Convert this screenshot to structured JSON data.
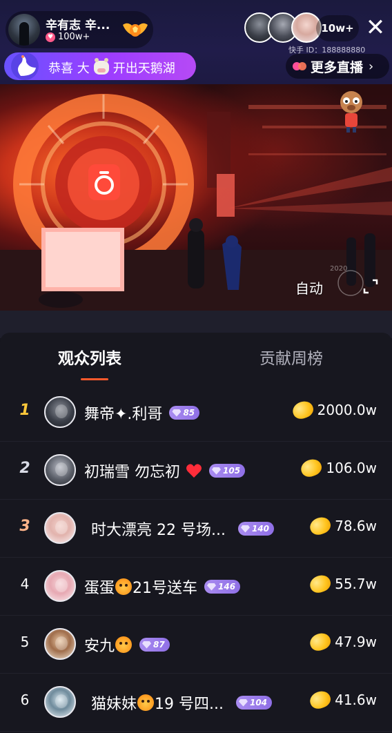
{
  "header": {
    "host_name": "辛有志 辛...",
    "host_likes": "100w+",
    "viewer_count": "10w+",
    "kuaishou_id": "快手 ID：188888880",
    "notification_prefix": "恭喜 大",
    "notification_suffix": "开出天鹅湖",
    "more_live_label": "更多直播",
    "close_symbol": "✕"
  },
  "video": {
    "auto_label": "自动"
  },
  "tabs": [
    {
      "label": "观众列表",
      "active": true
    },
    {
      "label": "贡献周榜",
      "active": false
    }
  ],
  "viewers": [
    {
      "rank": "1",
      "name": "舞帝✦.利哥",
      "level": "85",
      "coins": "2000.0w"
    },
    {
      "rank": "2",
      "name_main": "初瑞雪 勿忘初",
      "level": "105",
      "coins": "106.0w"
    },
    {
      "rank": "3",
      "name": "时大漂亮 22 号场...",
      "level": "140",
      "coins": "78.6w"
    },
    {
      "rank": "4",
      "name_a": "蛋蛋",
      "name_b": "21号送车",
      "level": "146",
      "coins": "55.7w"
    },
    {
      "rank": "5",
      "name_a": "安九",
      "level": "87",
      "coins": "47.9w"
    },
    {
      "rank": "6",
      "name_a": "猫妹妹",
      "name_b": " 19 号四...",
      "level": "104",
      "coins": "41.6w"
    }
  ],
  "colors": {
    "accent": "#ff5a2c",
    "rank1": "#ffc83a",
    "rank2": "#d9dbe6",
    "rank3": "#ffb48a",
    "badge": "#9a7cec",
    "panel_bg": "#17171f",
    "notify_gradient_start": "#6a52ff"
  }
}
